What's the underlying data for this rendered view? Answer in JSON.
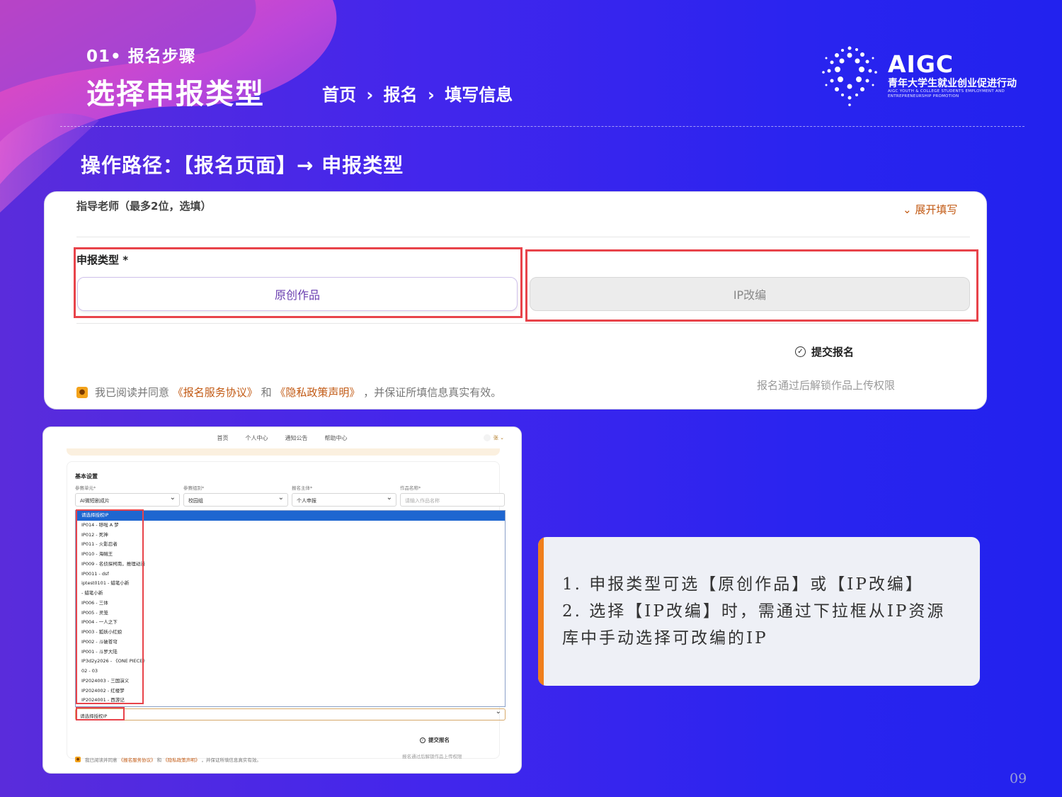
{
  "header": {
    "step_label": "01• 报名步骤",
    "title": "选择申报类型",
    "breadcrumb": [
      "首页",
      "›",
      "报名",
      "›",
      "填写信息"
    ]
  },
  "logo": {
    "name": "AIGC",
    "cn": "青年大学生就业创业促进行动",
    "en": "AIGC YOUTH & COLLEGE STUDENTS EMPLOYMENT AND ENTREPRENEURSHIP PROMOTION"
  },
  "path_text": "操作路径：【报名页面】→ 申报类型",
  "form_top": {
    "teacher_label": "指导老师（最多2位，选填）",
    "expand_label": "⌄ 展开填写",
    "type_label": "申报类型 *",
    "option_original": "原创作品",
    "option_ip": "IP改编",
    "submit_label": "提交报名",
    "submit_hint": "报名通过后解锁作品上传权限",
    "agree_prefix": "我已阅读并同意",
    "agree_link1": "《报名服务协议》",
    "agree_mid": "和",
    "agree_link2": "《隐私政策声明》",
    "agree_suffix": "，并保证所填信息真实有效。"
  },
  "form_bottom": {
    "nav": [
      "首页",
      "个人中心",
      "通知公告",
      "帮助中心"
    ],
    "user_label": "张 ⌄",
    "basic_settings": "基本设置",
    "fields": [
      {
        "label": "参赛单元*",
        "value": "AI微短剧成片"
      },
      {
        "label": "参赛组别*",
        "value": "校园组"
      },
      {
        "label": "报名主体*",
        "value": "个人申报"
      },
      {
        "label": "作品名称*",
        "placeholder": "请输入作品名称"
      }
    ],
    "ip_options": [
      "请选择授权IP",
      "IP014 - 哆啦 A 梦",
      "IP012 - 死神",
      "IP011 - 火影忍者",
      "IP010 - 海贼王",
      "IP009 - 名侦探柯南，推理动漫",
      "IP0011 - dsf",
      "iptest0101 - 蜡笔小新",
      "- 蜡笔小新",
      "IP006 - 三体",
      "IP005 - 灵笼",
      "IP004 - 一人之下",
      "IP003 - 狐妖小红娘",
      "IP002 - 斗破苍穹",
      "IP001 - 斗罗大陆",
      "IP3d2y2026 - 《ONE PIECE》",
      "02 - 03",
      "IP2024003 - 三国演义",
      "IP2024002 - 红楼梦",
      "IP2024001 - 西游记"
    ],
    "select_value": "请选择授权IP",
    "submit_label": "提交报名",
    "submit_hint": "报名通过后解锁作品上传权限",
    "agree_prefix": "我已阅读并同意",
    "agree_link1": "《报名服务协议》",
    "agree_mid": "和",
    "agree_link2": "《隐私政策声明》",
    "agree_suffix": "，并保证所填信息真实有效。"
  },
  "note": {
    "line1": "1.  申报类型可选【原创作品】或【IP改编】",
    "line2": "2.  选择【IP改编】时，需通过下拉框从IP资源库中手动选择可改编的IP"
  },
  "page_number": "09",
  "colors": {
    "highlight": "#e8434a",
    "accent": "#f07f1c",
    "link": "#c25a14"
  }
}
